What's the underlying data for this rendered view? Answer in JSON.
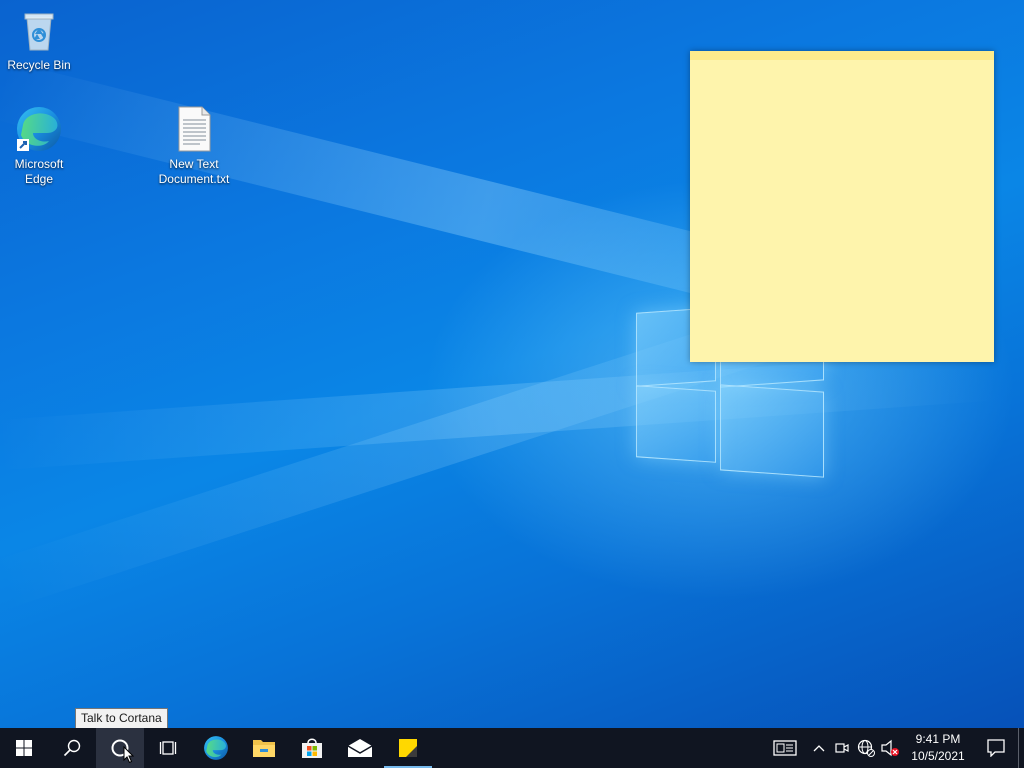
{
  "desktop": {
    "icons": [
      {
        "label": "Recycle Bin"
      },
      {
        "label": "Microsoft Edge"
      },
      {
        "label": "New Text Document.txt"
      }
    ]
  },
  "sticky_note": {
    "color": "#fef4ac"
  },
  "tooltip": {
    "text": "Talk to Cortana"
  },
  "taskbar": {
    "items": [
      "windows-start-icon",
      "search-icon",
      "cortana-icon",
      "task-view-icon",
      "edge-icon",
      "file-explorer-icon",
      "microsoft-store-icon",
      "mail-icon",
      "sticky-notes-icon"
    ],
    "tray": {
      "time": "9:41 PM",
      "date": "10/5/2021"
    }
  },
  "colors": {
    "taskbar": "#101521",
    "accent": "#76b9ed",
    "desktop": "#0a78e0"
  }
}
